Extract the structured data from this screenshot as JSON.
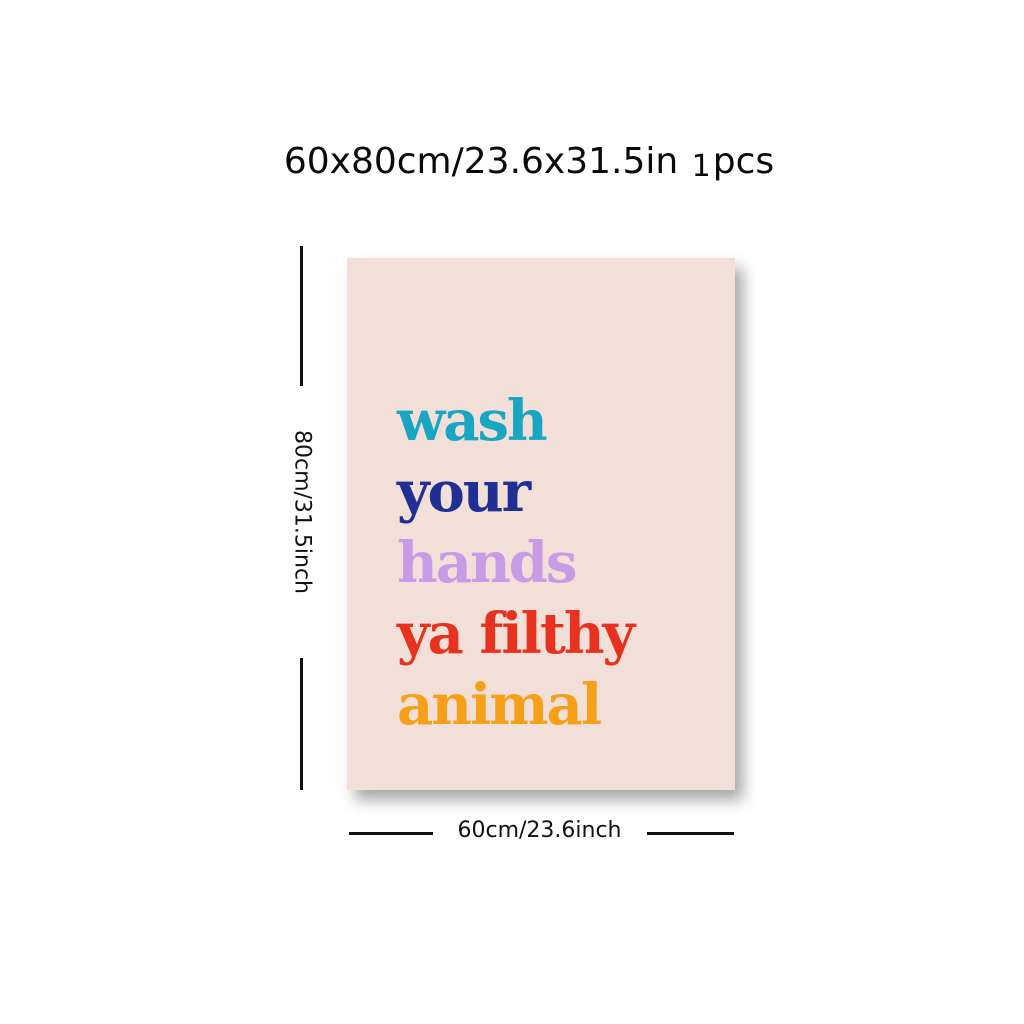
{
  "header": {
    "size_text": "60x80cm/23.6x31.5in",
    "quantity_number": "1",
    "quantity_unit": "pcs"
  },
  "dimensions": {
    "height_label": "80cm/31.5inch",
    "width_label": "60cm/23.6inch"
  },
  "poster": {
    "background": "#f2dfd8",
    "lines": [
      {
        "text": "wash",
        "color": "#1aa6c3"
      },
      {
        "text": "your",
        "color": "#1f2f94"
      },
      {
        "text": "hands",
        "color": "#c79be6"
      },
      {
        "text": "ya filthy",
        "color": "#e83220"
      },
      {
        "text": "animal",
        "color": "#f6a019"
      }
    ]
  }
}
